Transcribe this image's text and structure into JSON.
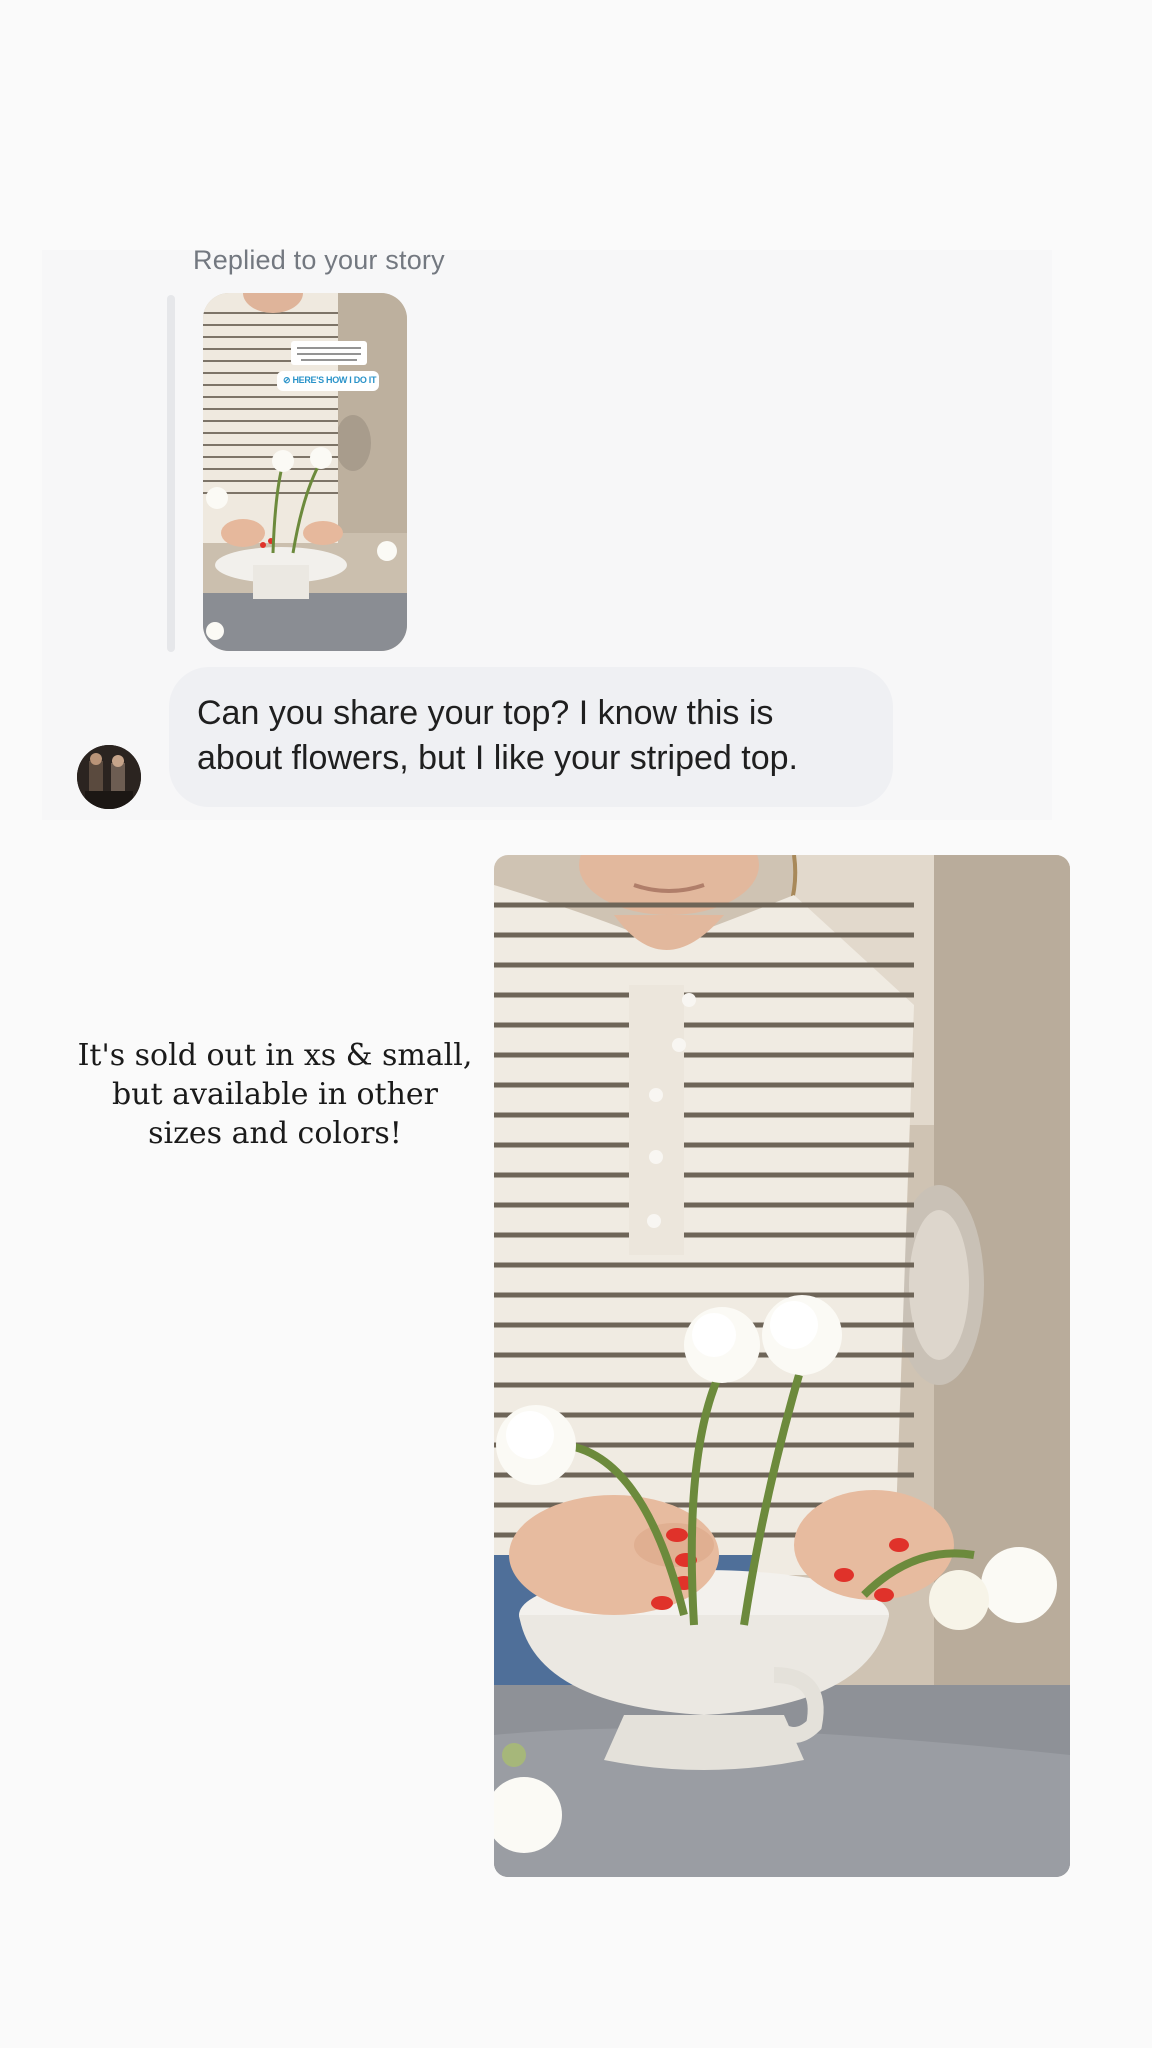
{
  "reply": {
    "label": "Replied to your story",
    "story_sticker": {
      "caption": "One of my favorite ways to style flowers (in particular ranunculus) in a bowl",
      "link_label": "HERE'S HOW I DO IT",
      "link_icon": "link-icon"
    }
  },
  "message": {
    "lines": [
      "Can you share your top? I know this is",
      "about flowers, but I like your striped top."
    ]
  },
  "shared_post": {
    "caption_lines": [
      "It's sold out in xs & small,",
      "but available in other",
      "sizes and colors!"
    ]
  },
  "colors": {
    "background": "#fafafa",
    "bubble": "#eff0f3",
    "label_gray": "#737880",
    "nail_red": "#e0322a",
    "link_blue": "#2a93c9"
  }
}
